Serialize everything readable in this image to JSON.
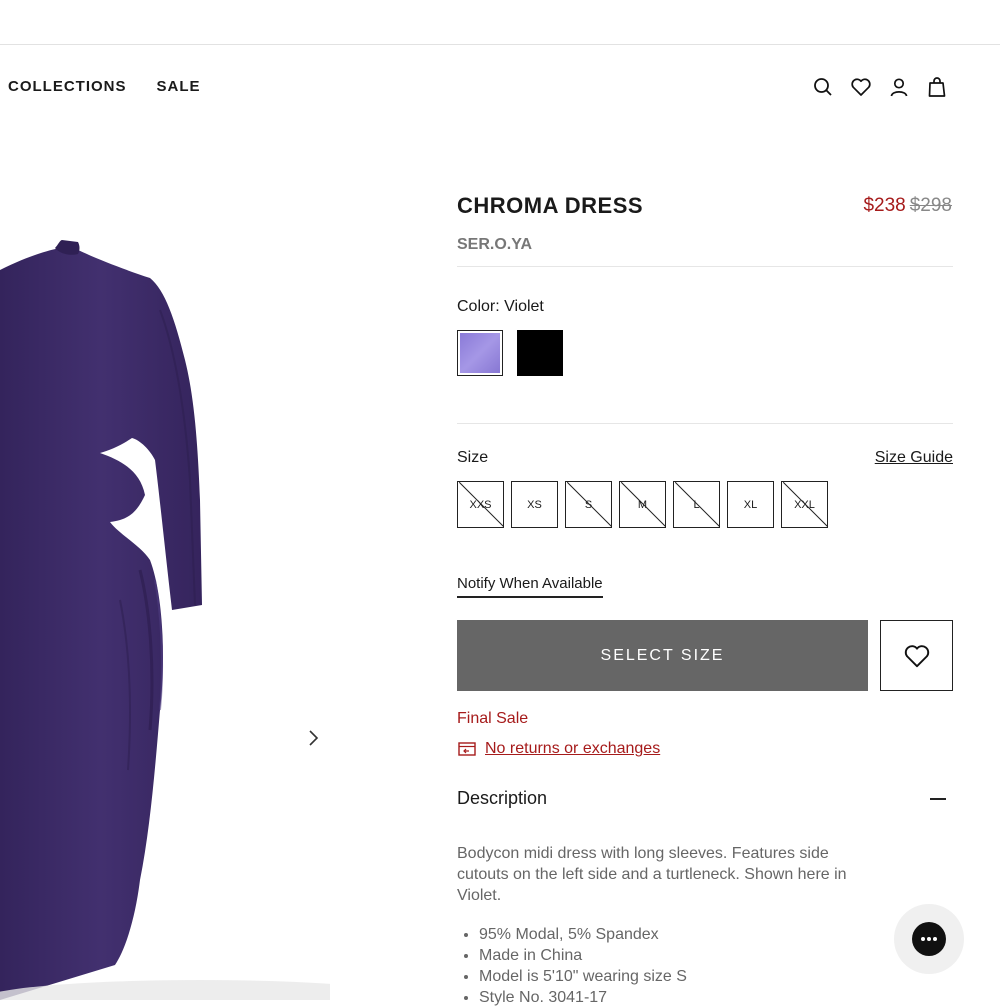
{
  "nav": {
    "collections": "COLLECTIONS",
    "sale": "SALE"
  },
  "header_icons": [
    "search-icon",
    "heart-icon",
    "account-icon",
    "bag-icon"
  ],
  "product": {
    "title": "CHROMA DRESS",
    "sale_price": "$238",
    "original_price": "$298",
    "brand": "SER.O.YA",
    "color_label": "Color: Violet",
    "colors": [
      {
        "name": "Violet",
        "hex": "#9a8ae0",
        "selected": true
      },
      {
        "name": "Black",
        "hex": "#000000",
        "selected": false
      }
    ],
    "size_label": "Size",
    "size_guide": "Size Guide",
    "sizes": [
      {
        "label": "XXS",
        "available": false
      },
      {
        "label": "XS",
        "available": true
      },
      {
        "label": "S",
        "available": false
      },
      {
        "label": "M",
        "available": false
      },
      {
        "label": "L",
        "available": false
      },
      {
        "label": "XL",
        "available": true
      },
      {
        "label": "XXL",
        "available": false
      }
    ],
    "notify": "Notify When Available",
    "select_size": "SELECT SIZE",
    "final_sale": "Final Sale",
    "returns": "No returns or exchanges",
    "description_heading": "Description",
    "description": "Bodycon midi dress with long sleeves. Features side cutouts on the left side and a turtleneck. Shown here in Violet.",
    "details": [
      "95% Modal, 5% Spandex",
      "Made in China",
      "Model is 5'10\" wearing size S",
      "Style No. 3041-17"
    ]
  },
  "colors": {
    "accent_red": "#a61b1b",
    "dress_purple": "#3e2a6b",
    "button_gray": "#666666"
  }
}
